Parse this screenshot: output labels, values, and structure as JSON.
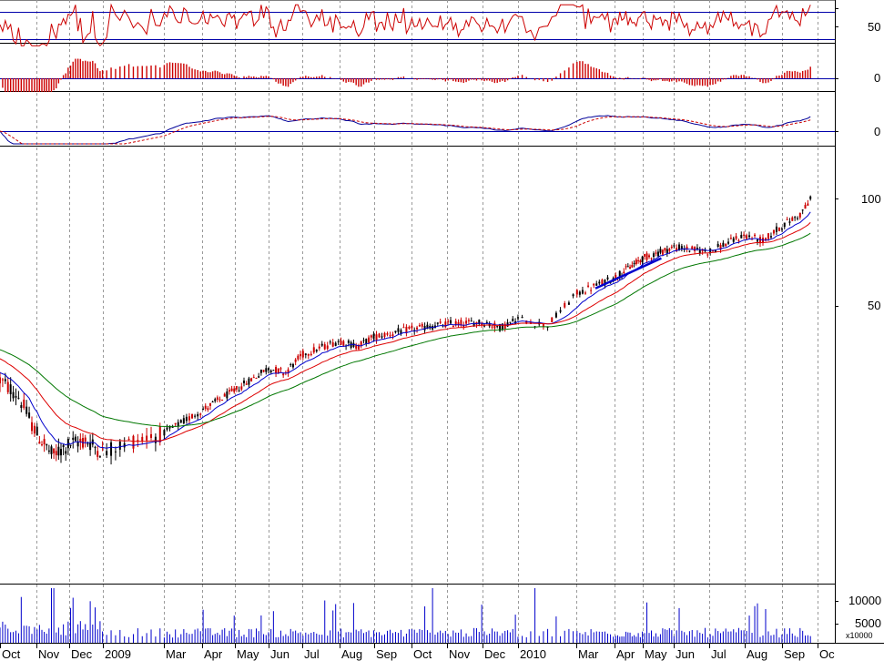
{
  "chart_data": {
    "type": "candlestick",
    "time_axis": {
      "labels": [
        "Oct",
        "Nov",
        "Dec",
        "2009",
        "Mar",
        "Apr",
        "May",
        "Jun",
        "Jul",
        "Aug",
        "Sep",
        "Oct",
        "Nov",
        "Dec",
        "2010",
        "Mar",
        "Apr",
        "May",
        "Jun",
        "Jul",
        "Aug",
        "Sep",
        "Oc"
      ]
    },
    "panels": {
      "oscillator_top": {
        "ticks": [
          {
            "label": "50",
            "value": 50
          }
        ],
        "reference_levels": [
          70,
          30
        ]
      },
      "histogram": {
        "ticks": [
          {
            "label": "0",
            "value": 0
          }
        ]
      },
      "macd_lines": {
        "ticks": [
          {
            "label": "0",
            "value": 0
          }
        ]
      },
      "price": {
        "scale": "log",
        "ticks": [
          {
            "label": "100",
            "value": 100
          },
          {
            "label": "50",
            "value": 50
          }
        ],
        "ylim": [
          15,
          130
        ],
        "moving_averages": [
          {
            "color": "#0000cc"
          },
          {
            "color": "#dd0000"
          },
          {
            "color": "#007700"
          }
        ],
        "trendline_color": "#0000cc"
      },
      "volume": {
        "ticks": [
          {
            "label": "10000",
            "value": 10000
          },
          {
            "label": "5000",
            "value": 5000
          }
        ],
        "multiplier_label": "x10000"
      }
    },
    "colors": {
      "up_candle": "#000000",
      "down_candle": "#cc0000",
      "oscillator": "#cc0000",
      "histogram": "#cc0000",
      "macd": "#000099",
      "signal": "#cc0000",
      "volume": "#0000cc",
      "reference_line": "#0000aa"
    },
    "price_anchors": [
      {
        "month": 0,
        "value": 31
      },
      {
        "month": 0.5,
        "value": 28
      },
      {
        "month": 1,
        "value": 22
      },
      {
        "month": 1.5,
        "value": 19
      },
      {
        "month": 2,
        "value": 20.5
      },
      {
        "month": 2.5,
        "value": 21
      },
      {
        "month": 3,
        "value": 19.5
      },
      {
        "month": 3.5,
        "value": 21
      },
      {
        "month": 4,
        "value": 22
      },
      {
        "month": 5,
        "value": 25.5
      },
      {
        "month": 6,
        "value": 29
      },
      {
        "month": 7,
        "value": 33.5
      },
      {
        "month": 7.5,
        "value": 32.5
      },
      {
        "month": 8,
        "value": 36.5
      },
      {
        "month": 9,
        "value": 40
      },
      {
        "month": 9.5,
        "value": 38.5
      },
      {
        "month": 10,
        "value": 41
      },
      {
        "month": 11,
        "value": 43
      },
      {
        "month": 12,
        "value": 44.5
      },
      {
        "month": 13,
        "value": 45
      },
      {
        "month": 13.5,
        "value": 43.5
      },
      {
        "month": 14,
        "value": 46
      },
      {
        "month": 14.5,
        "value": 44
      },
      {
        "month": 15,
        "value": 54
      },
      {
        "month": 16,
        "value": 60
      },
      {
        "month": 17,
        "value": 68
      },
      {
        "month": 18,
        "value": 73
      },
      {
        "month": 19,
        "value": 71
      },
      {
        "month": 20,
        "value": 79
      },
      {
        "month": 20.5,
        "value": 76
      },
      {
        "month": 21,
        "value": 84
      },
      {
        "month": 21.5,
        "value": 90
      },
      {
        "month": 21.8,
        "value": 99
      }
    ]
  }
}
